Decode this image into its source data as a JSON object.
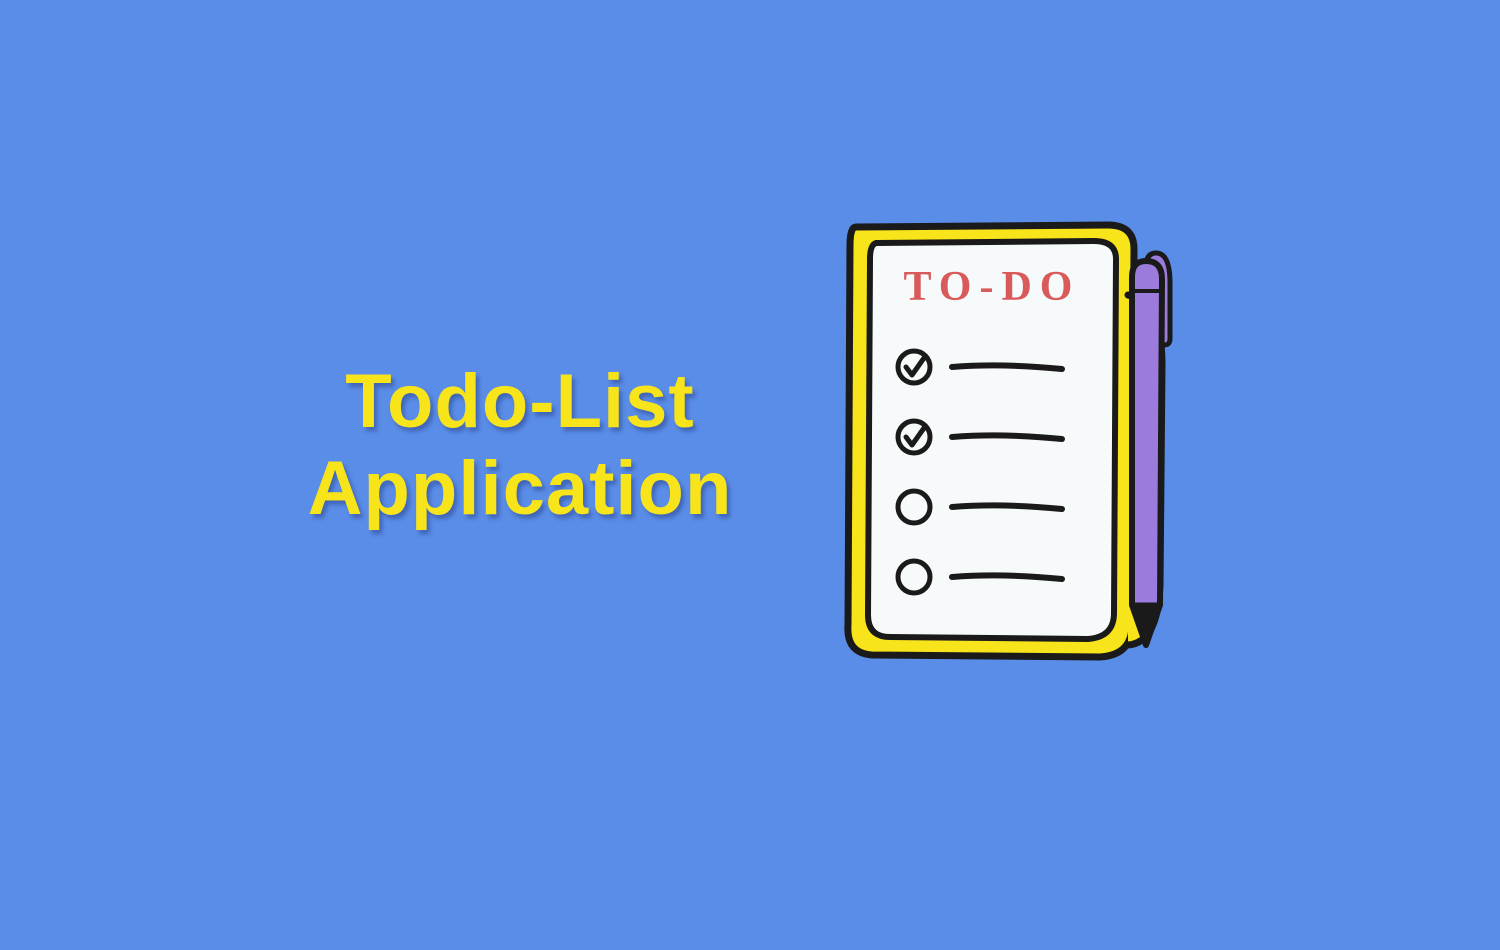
{
  "title": {
    "line1": "Todo-List",
    "line2": "Application"
  },
  "notepad": {
    "header": "TO-DO",
    "items": [
      {
        "checked": true
      },
      {
        "checked": true
      },
      {
        "checked": false
      },
      {
        "checked": false
      }
    ]
  },
  "colors": {
    "background": "#5A8DE8",
    "accent": "#F7E41B",
    "notepadOutline": "#1A1A1A",
    "notepadHeader": "#D85A5A",
    "pencilBody": "#9B7BDB",
    "paper": "#F7FAFA"
  }
}
